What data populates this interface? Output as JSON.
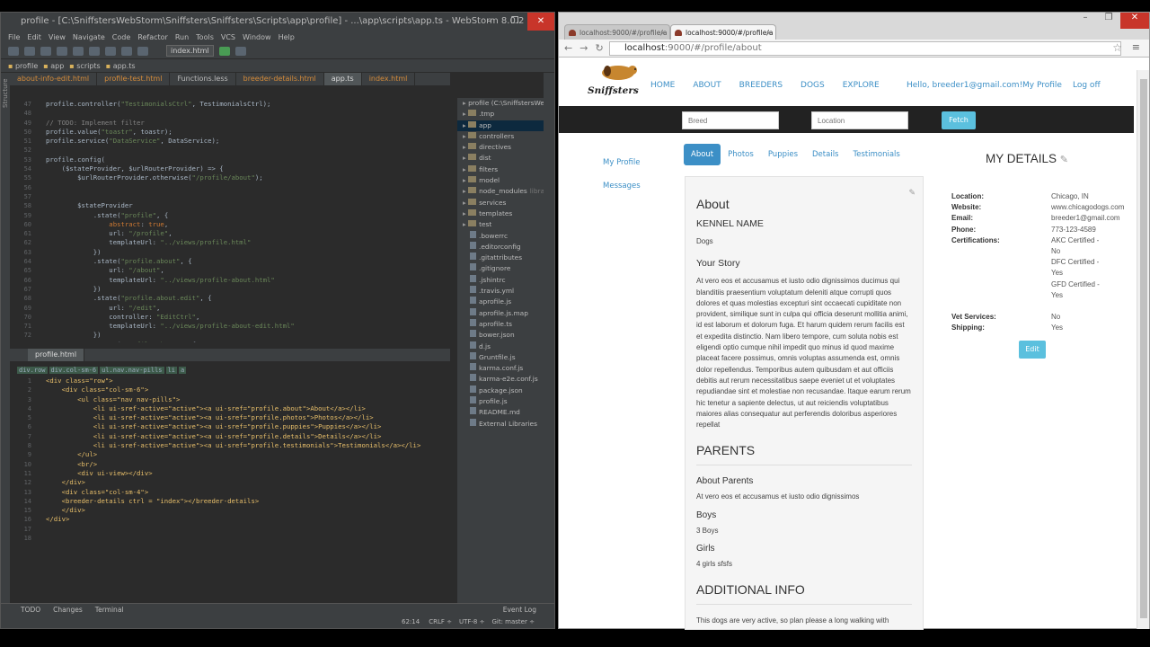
{
  "ide": {
    "title": "profile - [C:\\SniffstersWebStorm\\Sniffsters\\Sniffsters\\Scripts\\app\\profile] - ...\\app\\scripts\\app.ts - WebStorm 8.0.2",
    "menu": [
      "File",
      "Edit",
      "View",
      "Navigate",
      "Code",
      "Refactor",
      "Run",
      "Tools",
      "VCS",
      "Window",
      "Help"
    ],
    "run_config": "index.html",
    "breadcrumbs": [
      "profile",
      "app",
      "scripts",
      "app.ts"
    ],
    "tabs": [
      "about-info-edit.html",
      "profile-test.html",
      "Functions.less",
      "breeder-details.html",
      "app.ts",
      "index.html"
    ],
    "active_tab": "app.ts",
    "editor1_start_line": 47,
    "editor1_lines": [
      "profile.controller(\"TestimonialsCtrl\", TestimonialsCtrl);",
      "",
      "// TODO: Implement filter",
      "profile.value(\"toastr\", toastr);",
      "profile.service(\"DataService\", DataService);",
      "",
      "profile.config(",
      "    ($stateProvider, $urlRouterProvider) => {",
      "        $urlRouterProvider.otherwise(\"/profile/about\");",
      "",
      "",
      "        $stateProvider",
      "            .state(\"profile\", {",
      "                abstract: true,",
      "                url: \"/profile\",",
      "                templateUrl: \"../views/profile.html\"",
      "            })",
      "            .state(\"profile.about\", {",
      "                url: \"/about\",",
      "                templateUrl: \"../views/profile-about.html\"",
      "            })",
      "            .state(\"profile.about.edit\", {",
      "                url: \"/edit\",",
      "                controller: \"EditCtrl\",",
      "                templateUrl: \"../views/profile-about-edit.html\"",
      "            })",
      "            .state(\"profile.photos\", {"
    ],
    "editor2_tab": "profile.html",
    "editor2_crumbs": [
      "div.row",
      "div.col-sm-6",
      "ul.nav.nav-pills",
      "li",
      "a"
    ],
    "editor2_lines": [
      "<div class=\"row\">",
      "    <div class=\"col-sm-6\">",
      "        <ul class=\"nav nav-pills\">",
      "            <li ui-sref-active=\"active\"><a ui-sref=\"profile.about\">About</a></li>",
      "            <li ui-sref-active=\"active\"><a ui-sref=\"profile.photos\">Photos</a></li>",
      "            <li ui-sref-active=\"active\"><a ui-sref=\"profile.puppies\">Puppies</a></li>",
      "            <li ui-sref-active=\"active\"><a ui-sref=\"profile.details\">Details</a></li>",
      "            <li ui-sref-active=\"active\"><a ui-sref=\"profile.testimonials\">Testimonials</a></li>",
      "        </ul>",
      "        <br/>",
      "        <div ui-view></div>",
      "    </div>",
      "    <div class=\"col-sm-4\">",
      "    <breeder-details ctrl = \"index\"></breeder-details>",
      "    </div>",
      "</div>",
      "",
      ""
    ],
    "project_root": "profile (C:\\SniffstersWeb",
    "tree": [
      {
        "name": ".tmp",
        "dir": true
      },
      {
        "name": "app",
        "dir": true,
        "sel": true
      },
      {
        "name": "controllers",
        "dir": true
      },
      {
        "name": "directives",
        "dir": true
      },
      {
        "name": "dist",
        "dir": true
      },
      {
        "name": "filters",
        "dir": true
      },
      {
        "name": "model",
        "dir": true
      },
      {
        "name": "node_modules",
        "dir": true,
        "note": "libra"
      },
      {
        "name": "services",
        "dir": true
      },
      {
        "name": "templates",
        "dir": true
      },
      {
        "name": "test",
        "dir": true
      },
      {
        "name": ".bowerrc",
        "dir": false
      },
      {
        "name": ".editorconfig",
        "dir": false
      },
      {
        "name": ".gitattributes",
        "dir": false
      },
      {
        "name": ".gitignore",
        "dir": false
      },
      {
        "name": ".jshintrc",
        "dir": false
      },
      {
        "name": ".travis.yml",
        "dir": false
      },
      {
        "name": "aprofile.js",
        "dir": false
      },
      {
        "name": "aprofile.js.map",
        "dir": false
      },
      {
        "name": "aprofile.ts",
        "dir": false
      },
      {
        "name": "bower.json",
        "dir": false
      },
      {
        "name": "d.js",
        "dir": false
      },
      {
        "name": "Gruntfile.js",
        "dir": false
      },
      {
        "name": "karma.conf.js",
        "dir": false
      },
      {
        "name": "karma-e2e.conf.js",
        "dir": false
      },
      {
        "name": "package.json",
        "dir": false
      },
      {
        "name": "profile.js",
        "dir": false
      },
      {
        "name": "README.md",
        "dir": false
      },
      {
        "name": "External Libraries",
        "dir": false
      }
    ],
    "bottom_tabs": [
      "TODO",
      "Changes",
      "Terminal"
    ],
    "event_log": "Event Log",
    "status": {
      "pos": "62:14",
      "eol": "CRLF ÷",
      "enc": "UTF-8 ÷",
      "git": "Git: master ÷"
    },
    "side_labels": {
      "structure": "Structure",
      "project": "Project",
      "favorites": "Favorites"
    }
  },
  "browser": {
    "tabs": [
      "localhost:9000/#/profile/a",
      "localhost:9000/#/profile/a"
    ],
    "url_host": "localhost",
    "url_rest": ":9000/#/profile/about",
    "nav": [
      "HOME",
      "ABOUT",
      "BREEDERS",
      "DOGS",
      "EXPLORE"
    ],
    "greeting": "Hello, breeder1@gmail.com!",
    "my_profile": "My Profile",
    "log_off": "Log off",
    "breed_placeholder": "Breed",
    "location_placeholder": "Location",
    "fetch": "Fetch",
    "left_nav": [
      "My Profile",
      "Messages"
    ],
    "pills": [
      "About",
      "Photos",
      "Puppies",
      "Details",
      "Testimonials"
    ],
    "about": {
      "title": "About",
      "kennel_label": "KENNEL NAME",
      "kennel_value": "Dogs",
      "story_label": "Your Story",
      "story": "At vero eos et accusamus et iusto odio dignissimos ducimus qui blanditiis praesentium voluptatum deleniti atque corrupti quos dolores et quas molestias excepturi sint occaecati cupiditate non provident, similique sunt in culpa qui officia deserunt mollitia animi, id est laborum et dolorum fuga. Et harum quidem rerum facilis est et expedita distinctio. Nam libero tempore, cum soluta nobis est eligendi optio cumque nihil impedit quo minus id quod maxime placeat facere possimus, omnis voluptas assumenda est, omnis dolor repellendus. Temporibus autem quibusdam et aut officiis debitis aut rerum necessitatibus saepe eveniet ut et voluptates repudiandae sint et molestiae non recusandae. Itaque earum rerum hic tenetur a sapiente delectus, ut aut reiciendis voluptatibus maiores alias consequatur aut perferendis doloribus asperiores repellat",
      "parents_label": "PARENTS",
      "about_parents_label": "About Parents",
      "about_parents": "At vero eos et accusamus et iusto odio dignissimos",
      "boys_label": "Boys",
      "boys": "3 Boys",
      "girls_label": "Girls",
      "girls": "4 girls sfsfs",
      "additional_label": "ADDITIONAL INFO",
      "additional": "This dogs are very active, so plan please a long walking with"
    },
    "details": {
      "title": "MY DETAILS",
      "rows": [
        {
          "k": "Location:",
          "v": "Chicago, IN"
        },
        {
          "k": "Website:",
          "v": "www.chicagodogs.com"
        },
        {
          "k": "Email:",
          "v": "breeder1@gmail.com"
        },
        {
          "k": "Phone:",
          "v": "773-123-4589"
        },
        {
          "k": "Certifications:",
          "v": "AKC Certified -"
        },
        {
          "k": "",
          "v": "No"
        },
        {
          "k": "",
          "v": "DFC Certified -"
        },
        {
          "k": "",
          "v": "Yes"
        },
        {
          "k": "",
          "v": "GFD Certified -"
        },
        {
          "k": "",
          "v": "Yes"
        },
        {
          "k": "",
          "v": ""
        },
        {
          "k": "Vet Services:",
          "v": "No"
        },
        {
          "k": "Shipping:",
          "v": "Yes"
        }
      ],
      "edit": "Edit"
    },
    "logo_text": "Sniffsters"
  }
}
